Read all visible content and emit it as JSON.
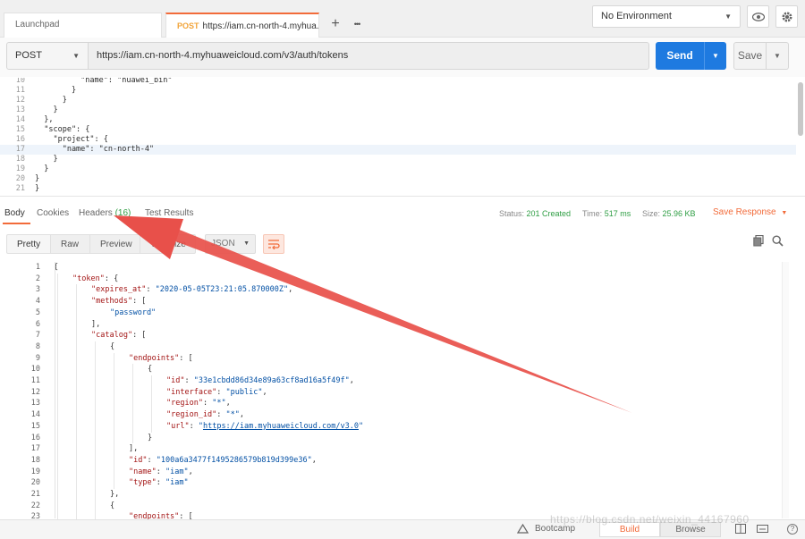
{
  "tabs": {
    "launchpad": "Launchpad",
    "active_method": "POST",
    "active_title": "https://iam.cn-north-4.myhua...",
    "add": "+",
    "more": "•••"
  },
  "environment": {
    "label": "No Environment"
  },
  "request": {
    "method": "POST",
    "url": "https://iam.cn-north-4.myhuaweicloud.com/v3/auth/tokens",
    "send_label": "Send",
    "save_label": "Save"
  },
  "request_body": [
    {
      "n": "10",
      "t": "          \"name\": \"huawei_bin\""
    },
    {
      "n": "11",
      "t": "        }"
    },
    {
      "n": "12",
      "t": "      }"
    },
    {
      "n": "13",
      "t": "    }"
    },
    {
      "n": "14",
      "t": "  },"
    },
    {
      "n": "15",
      "t": "  \"scope\": {"
    },
    {
      "n": "16",
      "t": "    \"project\": {"
    },
    {
      "n": "17",
      "t": "      \"name\": \"cn-north-4\""
    },
    {
      "n": "18",
      "t": "    }"
    },
    {
      "n": "19",
      "t": "  }"
    },
    {
      "n": "20",
      "t": "}"
    },
    {
      "n": "21",
      "t": "}"
    }
  ],
  "response_tabs": {
    "body": "Body",
    "cookies": "Cookies",
    "headers": "Headers",
    "headers_count": "(16)",
    "test_results": "Test Results"
  },
  "status": {
    "status_label": "Status:",
    "status_value": "201 Created",
    "time_label": "Time:",
    "time_value": "517 ms",
    "size_label": "Size:",
    "size_value": "25.96 KB",
    "save_response": "Save Response"
  },
  "view_modes": {
    "pretty": "Pretty",
    "raw": "Raw",
    "preview": "Preview",
    "visualize": "Visualize",
    "language": "JSON"
  },
  "response_body": [
    {
      "n": "1",
      "d": 0,
      "parts": [
        [
          "p",
          "{"
        ]
      ]
    },
    {
      "n": "2",
      "d": 1,
      "parts": [
        [
          "k",
          "\"token\""
        ],
        [
          "p",
          ": {"
        ]
      ]
    },
    {
      "n": "3",
      "d": 2,
      "parts": [
        [
          "k",
          "\"expires_at\""
        ],
        [
          "p",
          ": "
        ],
        [
          "s",
          "\"2020-05-05T23:21:05.870000Z\""
        ],
        [
          "p",
          ","
        ]
      ]
    },
    {
      "n": "4",
      "d": 2,
      "parts": [
        [
          "k",
          "\"methods\""
        ],
        [
          "p",
          ": ["
        ]
      ]
    },
    {
      "n": "5",
      "d": 3,
      "parts": [
        [
          "s",
          "\"password\""
        ]
      ]
    },
    {
      "n": "6",
      "d": 2,
      "parts": [
        [
          "p",
          "],"
        ]
      ]
    },
    {
      "n": "7",
      "d": 2,
      "parts": [
        [
          "k",
          "\"catalog\""
        ],
        [
          "p",
          ": ["
        ]
      ]
    },
    {
      "n": "8",
      "d": 3,
      "parts": [
        [
          "p",
          "{"
        ]
      ]
    },
    {
      "n": "9",
      "d": 4,
      "parts": [
        [
          "k",
          "\"endpoints\""
        ],
        [
          "p",
          ": ["
        ]
      ]
    },
    {
      "n": "10",
      "d": 5,
      "parts": [
        [
          "p",
          "{"
        ]
      ]
    },
    {
      "n": "11",
      "d": 6,
      "parts": [
        [
          "k",
          "\"id\""
        ],
        [
          "p",
          ": "
        ],
        [
          "s",
          "\"33e1cbdd86d34e89a63cf8ad16a5f49f\""
        ],
        [
          "p",
          ","
        ]
      ]
    },
    {
      "n": "12",
      "d": 6,
      "parts": [
        [
          "k",
          "\"interface\""
        ],
        [
          "p",
          ": "
        ],
        [
          "s",
          "\"public\""
        ],
        [
          "p",
          ","
        ]
      ]
    },
    {
      "n": "13",
      "d": 6,
      "parts": [
        [
          "k",
          "\"region\""
        ],
        [
          "p",
          ": "
        ],
        [
          "s",
          "\"*\""
        ],
        [
          "p",
          ","
        ]
      ]
    },
    {
      "n": "14",
      "d": 6,
      "parts": [
        [
          "k",
          "\"region_id\""
        ],
        [
          "p",
          ": "
        ],
        [
          "s",
          "\"*\""
        ],
        [
          "p",
          ","
        ]
      ]
    },
    {
      "n": "15",
      "d": 6,
      "parts": [
        [
          "k",
          "\"url\""
        ],
        [
          "p",
          ": "
        ],
        [
          "s",
          "\""
        ],
        [
          "u",
          "https://iam.myhuaweicloud.com/v3.0"
        ],
        [
          "s",
          "\""
        ]
      ]
    },
    {
      "n": "16",
      "d": 5,
      "parts": [
        [
          "p",
          "}"
        ]
      ]
    },
    {
      "n": "17",
      "d": 4,
      "parts": [
        [
          "p",
          "],"
        ]
      ]
    },
    {
      "n": "18",
      "d": 4,
      "parts": [
        [
          "k",
          "\"id\""
        ],
        [
          "p",
          ": "
        ],
        [
          "s",
          "\"100a6a3477f1495286579b819d399e36\""
        ],
        [
          "p",
          ","
        ]
      ]
    },
    {
      "n": "19",
      "d": 4,
      "parts": [
        [
          "k",
          "\"name\""
        ],
        [
          "p",
          ": "
        ],
        [
          "s",
          "\"iam\""
        ],
        [
          "p",
          ","
        ]
      ]
    },
    {
      "n": "20",
      "d": 4,
      "parts": [
        [
          "k",
          "\"type\""
        ],
        [
          "p",
          ": "
        ],
        [
          "s",
          "\"iam\""
        ]
      ]
    },
    {
      "n": "21",
      "d": 3,
      "parts": [
        [
          "p",
          "},"
        ]
      ]
    },
    {
      "n": "22",
      "d": 3,
      "parts": [
        [
          "p",
          "{"
        ]
      ]
    },
    {
      "n": "23",
      "d": 4,
      "parts": [
        [
          "k",
          "\"endpoints\""
        ],
        [
          "p",
          ": ["
        ]
      ]
    }
  ],
  "footer": {
    "bootcamp": "Bootcamp",
    "build": "Build",
    "browse": "Browse",
    "help": "?",
    "watermark": "https://blog.csdn.net/weixin_44167960"
  },
  "accent_color": "#f26b3a",
  "send_color": "#1e7ae0",
  "annotation_arrow_color": "#e8504a"
}
